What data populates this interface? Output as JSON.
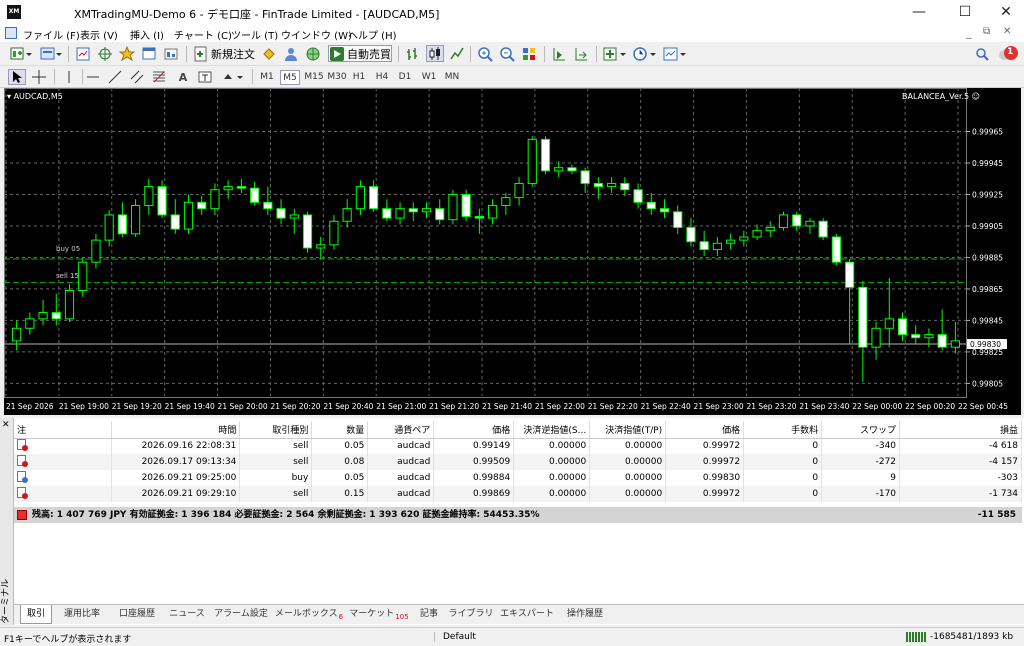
{
  "window": {
    "title": "XMTradingMU-Demo 6 - デモ口座 - FinTrade Limited - [AUDCAD,M5]",
    "app_logo": "XM",
    "minimize": "—",
    "maximize": "☐",
    "close": "✕"
  },
  "menu": [
    "ファイル (F)",
    "表示 (V)",
    "挿入 (I)",
    "チャート (C)",
    "ツール (T)",
    "ウインドウ (W)",
    "ヘルプ (H)"
  ],
  "menu_right": {
    "restore": "⧉",
    "notification_count": "1"
  },
  "toolbar": {
    "new_order": "新規注文",
    "auto_trading": "自動売買",
    "timeframes": [
      "M1",
      "M5",
      "M15",
      "M30",
      "H1",
      "H4",
      "D1",
      "W1",
      "MN"
    ],
    "active_timeframe": "M5"
  },
  "chart": {
    "symbol_label": "AUDCAD,M5",
    "ea_label": "BALANCEA_Ver.5 ☺",
    "current_price": "0.99830",
    "colors": {
      "bull": "#00ff00",
      "bear_fill": "#ffffff",
      "bull_fill": "#000000",
      "grid": "#666666",
      "bid_line": "#b4b4b4",
      "order_line": "#00b400"
    },
    "order_lines": [
      {
        "label": "buy 05",
        "price": 0.99884
      },
      {
        "label": "sell 15",
        "price": 0.99869
      }
    ],
    "price_ticks": [
      "0.99965",
      "0.99945",
      "0.99925",
      "0.99905",
      "0.99885",
      "0.99865",
      "0.99845",
      "0.99825",
      "0.99805"
    ],
    "time_ticks": [
      "21 Sep 2026",
      "21 Sep 19:00",
      "21 Sep 19:20",
      "21 Sep 19:40",
      "21 Sep 20:00",
      "21 Sep 20:20",
      "21 Sep 20:40",
      "21 Sep 21:00",
      "21 Sep 21:20",
      "21 Sep 21:40",
      "21 Sep 22:00",
      "21 Sep 22:20",
      "21 Sep 22:40",
      "21 Sep 23:00",
      "21 Sep 23:20",
      "21 Sep 23:40",
      "22 Sep 00:00",
      "22 Sep 00:20",
      "22 Sep 00:45"
    ]
  },
  "chart_data": {
    "type": "candlestick",
    "symbol": "AUDCAD",
    "timeframe": "M5",
    "ylim": [
      0.99797,
      0.99985
    ],
    "candles": [
      [
        0.99832,
        0.99845,
        0.99826,
        0.9984
      ],
      [
        0.9984,
        0.9985,
        0.99836,
        0.99846
      ],
      [
        0.99846,
        0.99858,
        0.99842,
        0.9985
      ],
      [
        0.9985,
        0.99862,
        0.99842,
        0.99846
      ],
      [
        0.99846,
        0.99868,
        0.99844,
        0.99864
      ],
      [
        0.99864,
        0.99885,
        0.9986,
        0.99882
      ],
      [
        0.99882,
        0.999,
        0.99878,
        0.99896
      ],
      [
        0.99896,
        0.99915,
        0.99892,
        0.99912
      ],
      [
        0.99912,
        0.9992,
        0.99898,
        0.999
      ],
      [
        0.999,
        0.99922,
        0.99898,
        0.99918
      ],
      [
        0.99918,
        0.99935,
        0.99912,
        0.9993
      ],
      [
        0.9993,
        0.99934,
        0.9991,
        0.99912
      ],
      [
        0.99912,
        0.99922,
        0.999,
        0.99903
      ],
      [
        0.99903,
        0.99925,
        0.999,
        0.9992
      ],
      [
        0.9992,
        0.99924,
        0.99912,
        0.99916
      ],
      [
        0.99916,
        0.99932,
        0.99912,
        0.99928
      ],
      [
        0.99928,
        0.99934,
        0.99922,
        0.9993
      ],
      [
        0.9993,
        0.99935,
        0.99926,
        0.99929
      ],
      [
        0.99929,
        0.99933,
        0.99918,
        0.9992
      ],
      [
        0.9992,
        0.9993,
        0.99912,
        0.99916
      ],
      [
        0.99916,
        0.99922,
        0.99906,
        0.9991
      ],
      [
        0.9991,
        0.99916,
        0.999,
        0.99912
      ],
      [
        0.99912,
        0.99914,
        0.99888,
        0.99891
      ],
      [
        0.99891,
        0.99898,
        0.99884,
        0.99893
      ],
      [
        0.99893,
        0.99912,
        0.9989,
        0.99908
      ],
      [
        0.99908,
        0.99922,
        0.99904,
        0.99916
      ],
      [
        0.99916,
        0.99934,
        0.99912,
        0.9993
      ],
      [
        0.9993,
        0.99934,
        0.99914,
        0.99916
      ],
      [
        0.99916,
        0.99922,
        0.99908,
        0.9991
      ],
      [
        0.9991,
        0.9992,
        0.99906,
        0.99916
      ],
      [
        0.99916,
        0.9992,
        0.99908,
        0.99914
      ],
      [
        0.99914,
        0.9992,
        0.9991,
        0.99916
      ],
      [
        0.99916,
        0.99922,
        0.99906,
        0.99909
      ],
      [
        0.99909,
        0.99928,
        0.99906,
        0.99925
      ],
      [
        0.99925,
        0.99928,
        0.99908,
        0.99911
      ],
      [
        0.99911,
        0.99916,
        0.999,
        0.9991
      ],
      [
        0.9991,
        0.99922,
        0.99906,
        0.99918
      ],
      [
        0.99918,
        0.99926,
        0.99912,
        0.99923
      ],
      [
        0.99923,
        0.99936,
        0.99918,
        0.99932
      ],
      [
        0.99932,
        0.99962,
        0.9993,
        0.9996
      ],
      [
        0.9996,
        0.99962,
        0.99938,
        0.9994
      ],
      [
        0.9994,
        0.99946,
        0.99936,
        0.99942
      ],
      [
        0.99942,
        0.99944,
        0.99938,
        0.9994
      ],
      [
        0.9994,
        0.99942,
        0.99926,
        0.99932
      ],
      [
        0.99932,
        0.99936,
        0.99922,
        0.9993
      ],
      [
        0.9993,
        0.99936,
        0.99926,
        0.99932
      ],
      [
        0.99932,
        0.99936,
        0.99924,
        0.99928
      ],
      [
        0.99928,
        0.99932,
        0.99916,
        0.9992
      ],
      [
        0.9992,
        0.99926,
        0.99912,
        0.99916
      ],
      [
        0.99916,
        0.99922,
        0.9991,
        0.99914
      ],
      [
        0.99914,
        0.99918,
        0.999,
        0.99904
      ],
      [
        0.99904,
        0.9991,
        0.99892,
        0.99895
      ],
      [
        0.99895,
        0.99902,
        0.99886,
        0.9989
      ],
      [
        0.9989,
        0.99898,
        0.99886,
        0.99894
      ],
      [
        0.99894,
        0.999,
        0.9989,
        0.99896
      ],
      [
        0.99896,
        0.99902,
        0.99892,
        0.99898
      ],
      [
        0.99898,
        0.99906,
        0.99896,
        0.99902
      ],
      [
        0.99902,
        0.99908,
        0.99898,
        0.99904
      ],
      [
        0.99904,
        0.99914,
        0.99902,
        0.99912
      ],
      [
        0.99912,
        0.99914,
        0.99902,
        0.99905
      ],
      [
        0.99905,
        0.9991,
        0.999,
        0.99908
      ],
      [
        0.99908,
        0.9991,
        0.99896,
        0.99898
      ],
      [
        0.99898,
        0.999,
        0.9988,
        0.99882
      ],
      [
        0.99882,
        0.99884,
        0.9983,
        0.99866
      ],
      [
        0.99866,
        0.9987,
        0.99806,
        0.99828
      ],
      [
        0.99828,
        0.99844,
        0.9982,
        0.9984
      ],
      [
        0.9984,
        0.99872,
        0.99828,
        0.99846
      ],
      [
        0.99846,
        0.9985,
        0.99832,
        0.99836
      ],
      [
        0.99836,
        0.99842,
        0.9983,
        0.99834
      ],
      [
        0.99834,
        0.9984,
        0.99828,
        0.99836
      ],
      [
        0.99836,
        0.99852,
        0.99826,
        0.99828
      ],
      [
        0.99828,
        0.99844,
        0.99824,
        0.99832
      ]
    ]
  },
  "terminal": {
    "side_label": "ターミナル",
    "columns": [
      "注",
      "時間",
      "取引種別",
      "数量",
      "通貨ペア",
      "価格",
      "決済逆指値(S...",
      "決済指値(T/P)",
      "価格",
      "手数料",
      "スワップ",
      "損益"
    ],
    "rows": [
      [
        "2026.09.16 22:08:31",
        "sell",
        "0.05",
        "audcad",
        "0.99149",
        "0.00000",
        "0.00000",
        "0.99972",
        "0",
        "-340",
        "-4 618"
      ],
      [
        "2026.09.17 09:13:34",
        "sell",
        "0.08",
        "audcad",
        "0.99509",
        "0.00000",
        "0.00000",
        "0.99972",
        "0",
        "-272",
        "-4 157"
      ],
      [
        "2026.09.21 09:25:00",
        "buy",
        "0.05",
        "audcad",
        "0.99884",
        "0.00000",
        "0.00000",
        "0.99830",
        "0",
        "9",
        "-303"
      ],
      [
        "2026.09.21 09:29:10",
        "sell",
        "0.15",
        "audcad",
        "0.99869",
        "0.00000",
        "0.00000",
        "0.99972",
        "0",
        "-170",
        "-1 734"
      ]
    ],
    "summary": "残高: 1 407 769 JPY  有効証拠金: 1 396 184  必要証拠金: 2 564  余剰証拠金: 1 393 620  証拠金維持率: 54453.35%",
    "summary_total": "-11 585",
    "tabs": [
      {
        "label": "取引"
      },
      {
        "label": "運用比率"
      },
      {
        "label": "口座履歴"
      },
      {
        "label": "ニュース"
      },
      {
        "label": "アラーム設定"
      },
      {
        "label": "メールボックス",
        "badge": "6"
      },
      {
        "label": "マーケット",
        "badge": "105"
      },
      {
        "label": "記事"
      },
      {
        "label": "ライブラリ"
      },
      {
        "label": "エキスパート"
      },
      {
        "label": "操作履歴"
      }
    ]
  },
  "status": {
    "help": "F1キーでヘルプが表示されます",
    "profile": "Default",
    "traffic": "-1685481/1893 kb"
  }
}
